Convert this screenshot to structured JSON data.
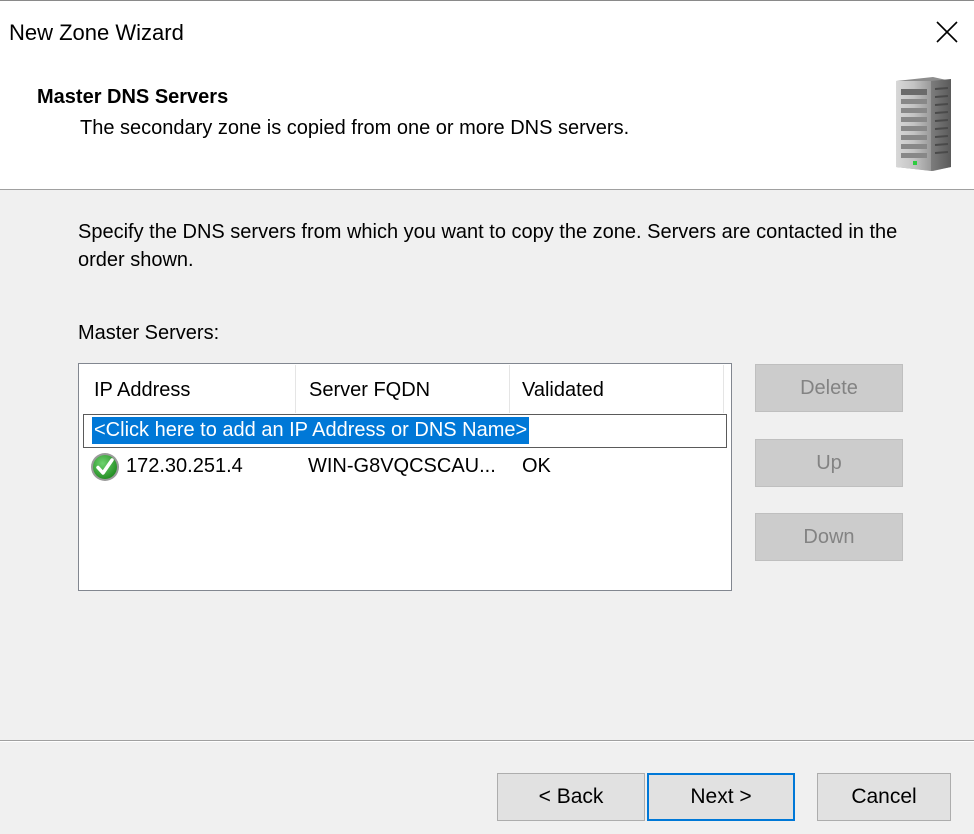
{
  "window": {
    "title": "New Zone Wizard"
  },
  "header": {
    "heading": "Master DNS Servers",
    "subheading": "The secondary zone is copied from one or more DNS servers."
  },
  "body": {
    "instructions": "Specify the DNS servers from which you want to copy the zone.  Servers are contacted in the order shown.",
    "master_label": "Master Servers:"
  },
  "list": {
    "columns": [
      "IP Address",
      "Server FQDN",
      "Validated"
    ],
    "edit_placeholder": "<Click here to add an IP Address or DNS Name>",
    "rows": [
      {
        "icon": "green-check-icon",
        "ip": "172.30.251.4",
        "fqdn": "WIN-G8VQCSCAU...",
        "validated": "OK"
      }
    ]
  },
  "side_buttons": {
    "delete": "Delete",
    "up": "Up",
    "down": "Down"
  },
  "footer": {
    "back": "< Back",
    "next": "Next >",
    "cancel": "Cancel"
  },
  "colors": {
    "selection": "#0078d7",
    "check_green": "#2e9e2e",
    "dialog_bg": "#f0f0f0"
  }
}
